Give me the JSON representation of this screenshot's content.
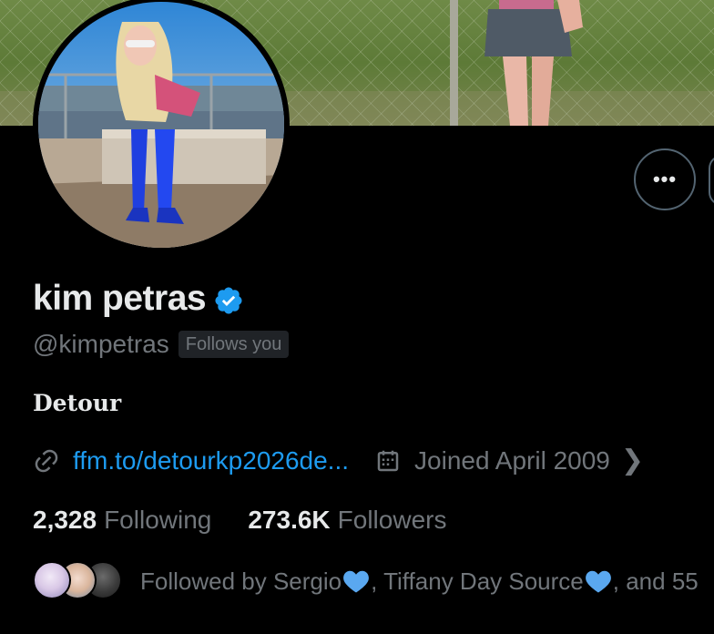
{
  "profile": {
    "display_name": "kim petras",
    "handle": "@kimpetras",
    "follows_you_badge": "Follows you",
    "bio": "Detour",
    "website": "ffm.to/detourkp2026de...",
    "joined": "Joined April 2009"
  },
  "stats": {
    "following_count": "2,328",
    "following_label": "Following",
    "followers_count": "273.6K",
    "followers_label": "Followers"
  },
  "followed_by": {
    "prefix": "Followed by Sergio",
    "middle": ", Tiffany Day Source ",
    "suffix": ", and 55"
  },
  "icons": {
    "verified": "verified-badge-icon",
    "more": "more-options-icon",
    "link": "link-icon",
    "calendar": "calendar-icon",
    "chevron": "chevron-right-icon",
    "heart": "blue-heart-icon"
  },
  "colors": {
    "background": "#000000",
    "primary_text": "#e7e9ea",
    "secondary_text": "#71767b",
    "link": "#1d9bf0",
    "verified": "#1d9bf0",
    "heart": "#5aa8f0",
    "border": "#536471"
  }
}
